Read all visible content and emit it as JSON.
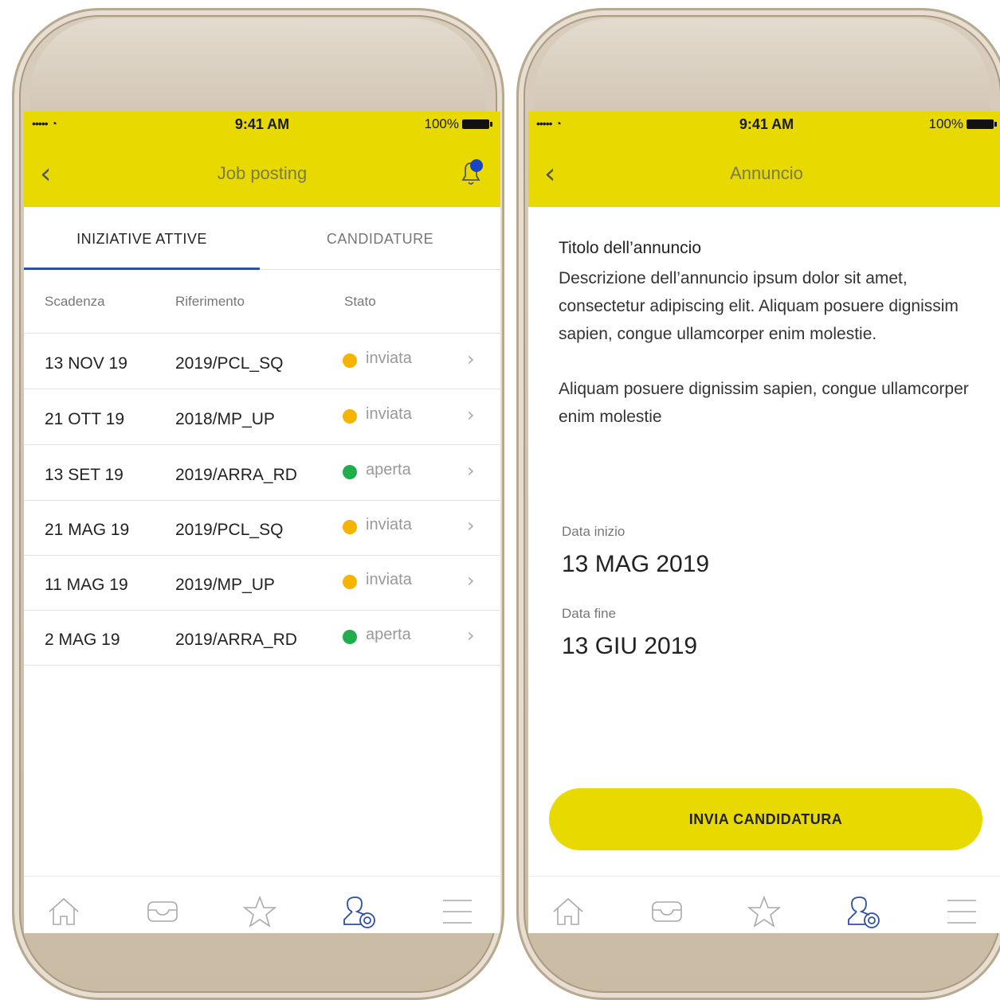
{
  "status": {
    "time": "9:41 AM",
    "battery": "100%",
    "signal": "•••••"
  },
  "left": {
    "title": "Job posting",
    "tabs": [
      {
        "label": "INIZIATIVE ATTIVE"
      },
      {
        "label": "CANDIDATURE"
      }
    ],
    "columns": {
      "scadenza": "Scadenza",
      "riferimento": "Riferimento",
      "stato": "Stato"
    },
    "rows": [
      {
        "date": "13 NOV 19",
        "ref": "2019/PCL_SQ",
        "status": "inviata",
        "color": "#f5b400"
      },
      {
        "date": "21 OTT  19",
        "ref": "2018/MP_UP",
        "status": "inviata",
        "color": "#f5b400"
      },
      {
        "date": "13 SET  19",
        "ref": "2019/ARRA_RD",
        "status": "aperta",
        "color": "#1fae4b"
      },
      {
        "date": "21 MAG 19",
        "ref": "2019/PCL_SQ",
        "status": "inviata",
        "color": "#f5b400"
      },
      {
        "date": "11  MAG 19",
        "ref": "2019/MP_UP",
        "status": "inviata",
        "color": "#f5b400"
      },
      {
        "date": "2  MAG 19",
        "ref": "2019/ARRA_RD",
        "status": "aperta",
        "color": "#1fae4b"
      }
    ]
  },
  "right": {
    "title": "Annuncio",
    "ad_title": "Titolo dell’annuncio",
    "ad_desc": "Descrizione dell’annuncio  ipsum dolor sit amet, consectetur adipiscing elit. Aliquam posuere dignissim sapien, congue ullamcorper enim molestie.",
    "ad_desc2": "Aliquam posuere dignissim sapien, congue ullamcorper enim molestie",
    "start_label": "Data inizio",
    "start_value": "13 MAG 2019",
    "end_label": "Data fine",
    "end_value": "13 GIU 2019",
    "cta": "INVIA CANDIDATURA"
  },
  "colors": {
    "brand_yellow": "#e8da00",
    "accent_blue": "#2c4fa8"
  },
  "tabbar_icons": [
    "home-icon",
    "inbox-icon",
    "star-icon",
    "profile-target-icon",
    "menu-icon"
  ]
}
